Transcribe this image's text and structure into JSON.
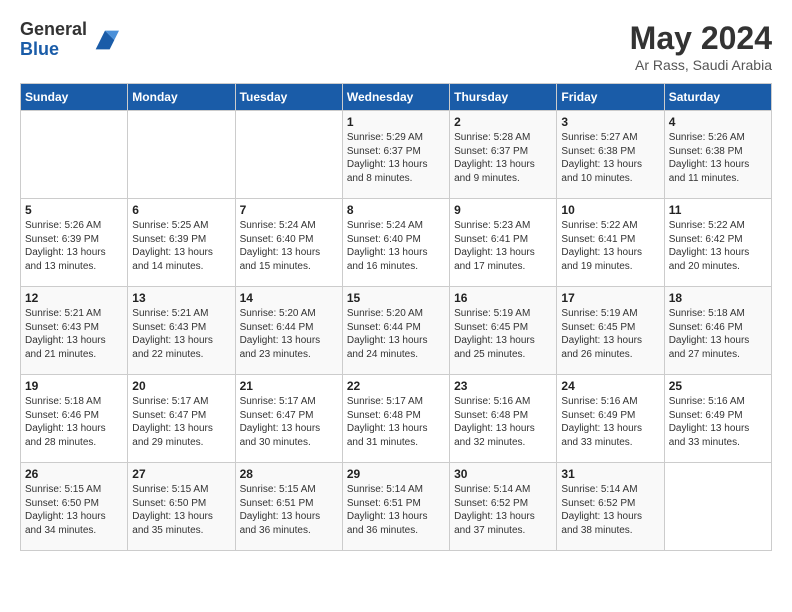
{
  "logo": {
    "general": "General",
    "blue": "Blue"
  },
  "title": "May 2024",
  "subtitle": "Ar Rass, Saudi Arabia",
  "days_of_week": [
    "Sunday",
    "Monday",
    "Tuesday",
    "Wednesday",
    "Thursday",
    "Friday",
    "Saturday"
  ],
  "weeks": [
    [
      {
        "day": "",
        "info": ""
      },
      {
        "day": "",
        "info": ""
      },
      {
        "day": "",
        "info": ""
      },
      {
        "day": "1",
        "info": "Sunrise: 5:29 AM\nSunset: 6:37 PM\nDaylight: 13 hours\nand 8 minutes."
      },
      {
        "day": "2",
        "info": "Sunrise: 5:28 AM\nSunset: 6:37 PM\nDaylight: 13 hours\nand 9 minutes."
      },
      {
        "day": "3",
        "info": "Sunrise: 5:27 AM\nSunset: 6:38 PM\nDaylight: 13 hours\nand 10 minutes."
      },
      {
        "day": "4",
        "info": "Sunrise: 5:26 AM\nSunset: 6:38 PM\nDaylight: 13 hours\nand 11 minutes."
      }
    ],
    [
      {
        "day": "5",
        "info": "Sunrise: 5:26 AM\nSunset: 6:39 PM\nDaylight: 13 hours\nand 13 minutes."
      },
      {
        "day": "6",
        "info": "Sunrise: 5:25 AM\nSunset: 6:39 PM\nDaylight: 13 hours\nand 14 minutes."
      },
      {
        "day": "7",
        "info": "Sunrise: 5:24 AM\nSunset: 6:40 PM\nDaylight: 13 hours\nand 15 minutes."
      },
      {
        "day": "8",
        "info": "Sunrise: 5:24 AM\nSunset: 6:40 PM\nDaylight: 13 hours\nand 16 minutes."
      },
      {
        "day": "9",
        "info": "Sunrise: 5:23 AM\nSunset: 6:41 PM\nDaylight: 13 hours\nand 17 minutes."
      },
      {
        "day": "10",
        "info": "Sunrise: 5:22 AM\nSunset: 6:41 PM\nDaylight: 13 hours\nand 19 minutes."
      },
      {
        "day": "11",
        "info": "Sunrise: 5:22 AM\nSunset: 6:42 PM\nDaylight: 13 hours\nand 20 minutes."
      }
    ],
    [
      {
        "day": "12",
        "info": "Sunrise: 5:21 AM\nSunset: 6:43 PM\nDaylight: 13 hours\nand 21 minutes."
      },
      {
        "day": "13",
        "info": "Sunrise: 5:21 AM\nSunset: 6:43 PM\nDaylight: 13 hours\nand 22 minutes."
      },
      {
        "day": "14",
        "info": "Sunrise: 5:20 AM\nSunset: 6:44 PM\nDaylight: 13 hours\nand 23 minutes."
      },
      {
        "day": "15",
        "info": "Sunrise: 5:20 AM\nSunset: 6:44 PM\nDaylight: 13 hours\nand 24 minutes."
      },
      {
        "day": "16",
        "info": "Sunrise: 5:19 AM\nSunset: 6:45 PM\nDaylight: 13 hours\nand 25 minutes."
      },
      {
        "day": "17",
        "info": "Sunrise: 5:19 AM\nSunset: 6:45 PM\nDaylight: 13 hours\nand 26 minutes."
      },
      {
        "day": "18",
        "info": "Sunrise: 5:18 AM\nSunset: 6:46 PM\nDaylight: 13 hours\nand 27 minutes."
      }
    ],
    [
      {
        "day": "19",
        "info": "Sunrise: 5:18 AM\nSunset: 6:46 PM\nDaylight: 13 hours\nand 28 minutes."
      },
      {
        "day": "20",
        "info": "Sunrise: 5:17 AM\nSunset: 6:47 PM\nDaylight: 13 hours\nand 29 minutes."
      },
      {
        "day": "21",
        "info": "Sunrise: 5:17 AM\nSunset: 6:47 PM\nDaylight: 13 hours\nand 30 minutes."
      },
      {
        "day": "22",
        "info": "Sunrise: 5:17 AM\nSunset: 6:48 PM\nDaylight: 13 hours\nand 31 minutes."
      },
      {
        "day": "23",
        "info": "Sunrise: 5:16 AM\nSunset: 6:48 PM\nDaylight: 13 hours\nand 32 minutes."
      },
      {
        "day": "24",
        "info": "Sunrise: 5:16 AM\nSunset: 6:49 PM\nDaylight: 13 hours\nand 33 minutes."
      },
      {
        "day": "25",
        "info": "Sunrise: 5:16 AM\nSunset: 6:49 PM\nDaylight: 13 hours\nand 33 minutes."
      }
    ],
    [
      {
        "day": "26",
        "info": "Sunrise: 5:15 AM\nSunset: 6:50 PM\nDaylight: 13 hours\nand 34 minutes."
      },
      {
        "day": "27",
        "info": "Sunrise: 5:15 AM\nSunset: 6:50 PM\nDaylight: 13 hours\nand 35 minutes."
      },
      {
        "day": "28",
        "info": "Sunrise: 5:15 AM\nSunset: 6:51 PM\nDaylight: 13 hours\nand 36 minutes."
      },
      {
        "day": "29",
        "info": "Sunrise: 5:14 AM\nSunset: 6:51 PM\nDaylight: 13 hours\nand 36 minutes."
      },
      {
        "day": "30",
        "info": "Sunrise: 5:14 AM\nSunset: 6:52 PM\nDaylight: 13 hours\nand 37 minutes."
      },
      {
        "day": "31",
        "info": "Sunrise: 5:14 AM\nSunset: 6:52 PM\nDaylight: 13 hours\nand 38 minutes."
      },
      {
        "day": "",
        "info": ""
      }
    ]
  ]
}
